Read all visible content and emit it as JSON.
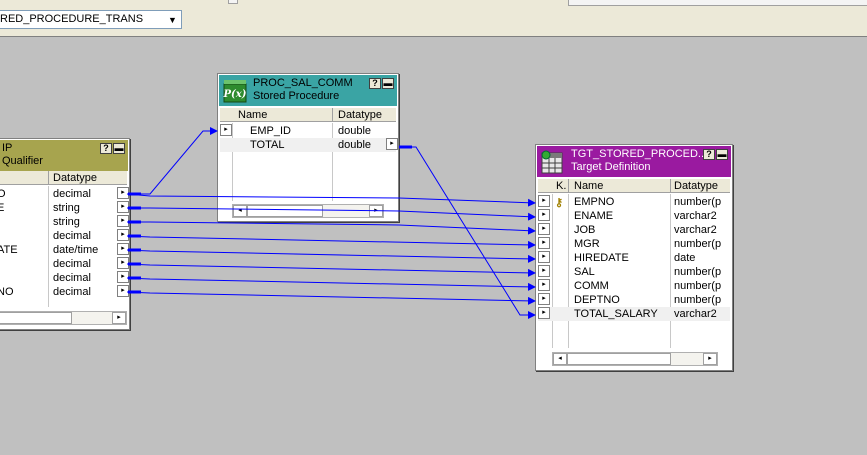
{
  "toolbar": {
    "mapping_select": {
      "value": "RED_PROCEDURE_TRANS",
      "arrow": "▼"
    }
  },
  "source_qualifier": {
    "title": "IP",
    "subtitle": "Qualifier",
    "col_datatype": "Datatype",
    "rows": [
      {
        "name": "O",
        "datatype": "decimal"
      },
      {
        "name": "E",
        "datatype": "string"
      },
      {
        "name": "",
        "datatype": "string"
      },
      {
        "name": "",
        "datatype": "decimal"
      },
      {
        "name": "ATE",
        "datatype": "date/time"
      },
      {
        "name": "",
        "datatype": "decimal"
      },
      {
        "name": "",
        "datatype": "decimal"
      },
      {
        "name": "NO",
        "datatype": "decimal"
      }
    ]
  },
  "stored_procedure": {
    "title": "PROC_SAL_COMM",
    "subtitle": "Stored Procedure",
    "col_name": "Name",
    "col_datatype": "Datatype",
    "rows": [
      {
        "name": "EMP_ID",
        "datatype": "double"
      },
      {
        "name": "TOTAL",
        "datatype": "double"
      }
    ]
  },
  "target_definition": {
    "title": "TGT_STORED_PROCED...",
    "subtitle": "Target Definition",
    "col_key": "K.",
    "col_name": "Name",
    "col_datatype": "Datatype",
    "rows": [
      {
        "name": "EMPNO",
        "datatype": "number(p"
      },
      {
        "name": "ENAME",
        "datatype": "varchar2"
      },
      {
        "name": "JOB",
        "datatype": "varchar2"
      },
      {
        "name": "MGR",
        "datatype": "number(p"
      },
      {
        "name": "HIREDATE",
        "datatype": "date"
      },
      {
        "name": "SAL",
        "datatype": "number(p"
      },
      {
        "name": "COMM",
        "datatype": "number(p"
      },
      {
        "name": "DEPTNO",
        "datatype": "number(p"
      },
      {
        "name": "TOTAL_SALARY",
        "datatype": "varchar2"
      }
    ]
  },
  "glyphs": {
    "minimize": "▬",
    "help": "?",
    "port_arrow": "▸",
    "scroll_left": "◂",
    "scroll_right": "▸",
    "key": "⚷"
  },
  "colors": {
    "link": "#0000ff",
    "sq_header": "#a7a44e",
    "sp_header": "#3aa4a4",
    "tgt_header": "#9a1aa0"
  }
}
